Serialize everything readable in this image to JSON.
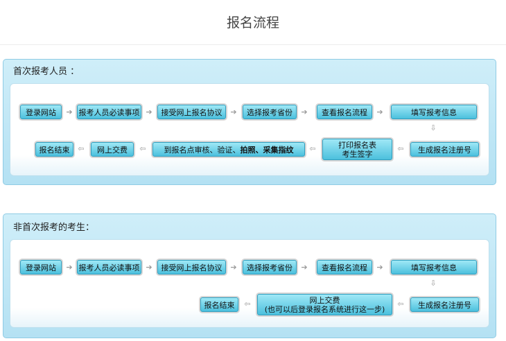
{
  "page": {
    "title": "报名流程"
  },
  "panels": [
    {
      "title": "首次报考人员 ：",
      "nodes": {
        "n1": "登录网站",
        "n2": "报考人员必读事项",
        "n3": "接受网上报名协议",
        "n4": "选择报考省份",
        "n5": "查看报名流程",
        "n6": "填写报考信息",
        "n7": "生成报名注册号",
        "n8_line1": "打印报名表",
        "n8_line2": "考生签字",
        "n9_part1": "到报名点审核、验证、",
        "n9_part2": "拍照、采集指纹",
        "n10": "网上交费",
        "n11": "报名结束"
      }
    },
    {
      "title": "非首次报考的考生：",
      "nodes": {
        "n1": "登录网站",
        "n2": "报考人员必读事项",
        "n3": "接受网上报名协议",
        "n4": "选择报考省份",
        "n5": "查看报名流程",
        "n6": "填写报考信息",
        "n7": "生成报名注册号",
        "n8_line1": "网上交费",
        "n8_line2": "(也可以后登录报名系统进行这一步)",
        "n9": "报名结束"
      }
    }
  ],
  "arrows": {
    "right": "➔",
    "left": "⇦",
    "down": "⇩"
  }
}
